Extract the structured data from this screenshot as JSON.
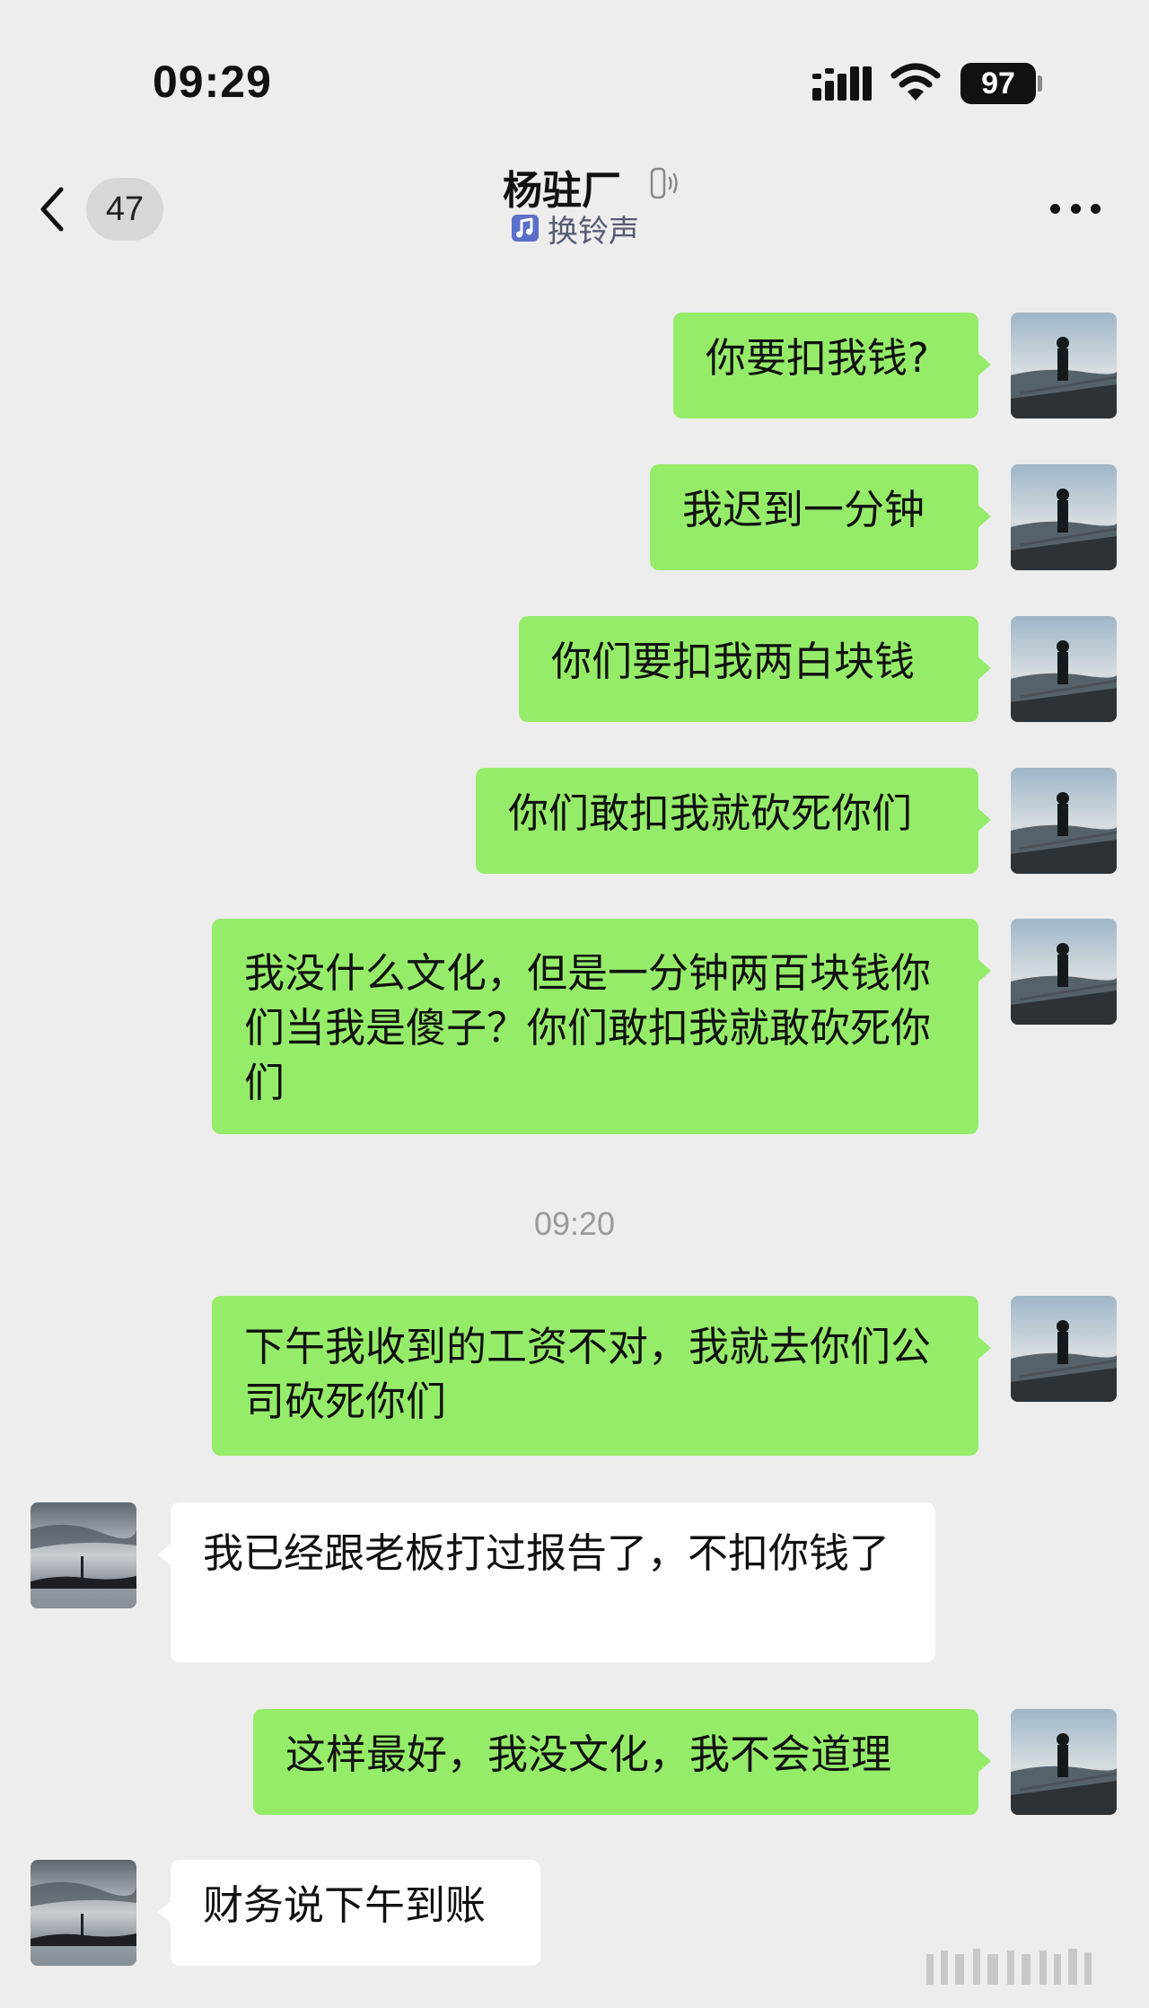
{
  "status_bar": {
    "time": "09:29",
    "battery": "97"
  },
  "header": {
    "unread_count": "47",
    "contact_name": "杨驻厂",
    "ringtone_label": "换铃声"
  },
  "messages": [
    {
      "sender": "me",
      "text": "你要扣我钱?"
    },
    {
      "sender": "me",
      "text": "我迟到一分钟"
    },
    {
      "sender": "me",
      "text": "你们要扣我两白块钱"
    },
    {
      "sender": "me",
      "text": "你们敢扣我就砍死你们"
    },
    {
      "sender": "me",
      "text": "我没什么文化，但是一分钟两百块钱你们当我是傻子？你们敢扣我就敢砍死你们"
    },
    {
      "sender": "me",
      "text": "下午我收到的工资不对，我就去你们公司砍死你们"
    },
    {
      "sender": "contact",
      "text": "我已经跟老板打过报告了，不扣你钱了"
    },
    {
      "sender": "me",
      "text": "这样最好，我没文化，我不会道理"
    },
    {
      "sender": "contact",
      "text": "财务说下午到账"
    }
  ],
  "timestamp_divider": "09:20",
  "colors": {
    "outgoing_bubble": "#95ec69",
    "incoming_bubble": "#ffffff",
    "background": "#ededed"
  }
}
